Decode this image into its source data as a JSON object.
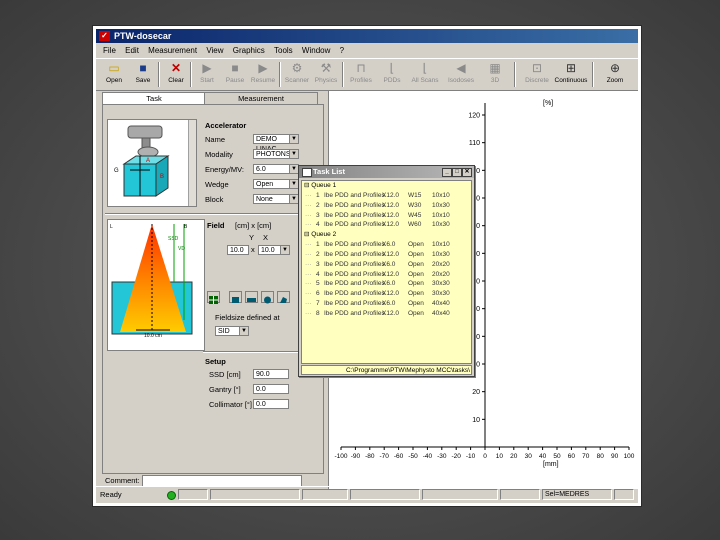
{
  "window": {
    "title": "PTW-dosecar"
  },
  "menu": [
    "File",
    "Edit",
    "Measurement",
    "View",
    "Graphics",
    "Tools",
    "Window",
    "?"
  ],
  "toolbar": [
    {
      "label": "Open",
      "icon": "open-folder-icon",
      "enabled": true
    },
    {
      "label": "Save",
      "icon": "save-disk-icon",
      "enabled": true
    },
    {
      "label": "Clear",
      "icon": "clear-x-icon",
      "enabled": true
    },
    {
      "label": "Start",
      "icon": "start-icon",
      "enabled": false
    },
    {
      "label": "Pause",
      "icon": "pause-icon",
      "enabled": false
    },
    {
      "label": "Resume",
      "icon": "resume-icon",
      "enabled": false
    },
    {
      "label": "Scanner",
      "icon": "scanner-icon",
      "enabled": false
    },
    {
      "label": "Physics",
      "icon": "physics-tools-icon",
      "enabled": false
    },
    {
      "label": "Profiles",
      "icon": "profiles-icon",
      "enabled": false
    },
    {
      "label": "PDDs",
      "icon": "pdds-icon",
      "enabled": false
    },
    {
      "label": "All Scans",
      "icon": "all-scans-icon",
      "enabled": false
    },
    {
      "label": "Isodoses",
      "icon": "isodoses-icon",
      "enabled": false
    },
    {
      "label": "3D",
      "icon": "3d-icon",
      "enabled": false
    },
    {
      "label": "Discrete",
      "icon": "discrete-icon",
      "enabled": false
    },
    {
      "label": "Continuous",
      "icon": "continuous-icon",
      "enabled": true
    },
    {
      "label": "Zoom",
      "icon": "zoom-icon",
      "enabled": true
    }
  ],
  "tabs": {
    "left": "Task",
    "right": "Measurement"
  },
  "accelerator": {
    "title": "Accelerator",
    "name_label": "Name",
    "name_value": "DEMO LINAC",
    "modality_label": "Modality",
    "modality_value": "PHOTONS",
    "energy_label": "Energy/MV:",
    "energy_value": "6.0",
    "wedge_label": "Wedge",
    "wedge_value": "Open",
    "block_label": "Block",
    "block_value": "None"
  },
  "field": {
    "title": "Field",
    "unit_text": "[cm] x [cm]",
    "y_label": "Y",
    "x_label": "X",
    "y_value": "10.0",
    "x_value": "10.0",
    "defined_label": "Fieldsize defined at",
    "defined_value": "SID"
  },
  "setup": {
    "title": "Setup",
    "ssd_label": "SSD [cm]",
    "ssd_value": "90.0",
    "gantry_label": "Gantry [°]",
    "gantry_value": "0.0",
    "collimator_label": "Collimator [°]",
    "collimator_value": "0.0"
  },
  "beam_diagram": {
    "ssd_label": "SSD",
    "vd_label": "VD",
    "width_label": "10.0 cm",
    "b_label": "B",
    "l_label": "L"
  },
  "comment": {
    "label": "Comment:",
    "value": ""
  },
  "statusbar": {
    "text": "Ready",
    "right_text": "Sel=MEDRES"
  },
  "chart_data": {
    "type": "line",
    "series": [],
    "ylabel": "[%]",
    "xlabel": "[mm]",
    "ylim": [
      0,
      120
    ],
    "xlim": [
      -100,
      100
    ],
    "y_ticks": [
      10,
      20,
      30,
      40,
      50,
      60,
      70,
      80,
      90,
      100,
      110,
      120
    ],
    "x_ticks": [
      -100,
      -90,
      -80,
      -70,
      -60,
      -50,
      -40,
      -30,
      -20,
      -10,
      0,
      10,
      20,
      30,
      40,
      50,
      60,
      70,
      80,
      90,
      100
    ]
  },
  "task_list": {
    "title": "Task List",
    "queues": [
      {
        "name": "Queue 1",
        "rows": [
          {
            "n": "1",
            "desc": "Ibe PDD and Profiles",
            "size": "X12.0",
            "wedge": "W15",
            "field": "10x10"
          },
          {
            "n": "2",
            "desc": "Ibe PDD and Profiles",
            "size": "X12.0",
            "wedge": "W30",
            "field": "10x30"
          },
          {
            "n": "3",
            "desc": "Ibe PDD and Profiles",
            "size": "X12.0",
            "wedge": "W45",
            "field": "10x10"
          },
          {
            "n": "4",
            "desc": "Ibe PDD and Profiles",
            "size": "X12.0",
            "wedge": "W60",
            "field": "10x30"
          }
        ]
      },
      {
        "name": "Queue 2",
        "rows": [
          {
            "n": "1",
            "desc": "Ibe PDD and Profiles",
            "size": "X6.0",
            "wedge": "Open",
            "field": "10x10"
          },
          {
            "n": "2",
            "desc": "Ibe PDD and Profiles",
            "size": "X12.0",
            "wedge": "Open",
            "field": "10x30"
          },
          {
            "n": "3",
            "desc": "Ibe PDD and Profiles",
            "size": "X6.0",
            "wedge": "Open",
            "field": "20x20"
          },
          {
            "n": "4",
            "desc": "Ibe PDD and Profiles",
            "size": "X12.0",
            "wedge": "Open",
            "field": "20x20"
          },
          {
            "n": "5",
            "desc": "Ibe PDD and Profiles",
            "size": "X6.0",
            "wedge": "Open",
            "field": "30x30"
          },
          {
            "n": "6",
            "desc": "Ibe PDD and Profiles",
            "size": "X12.0",
            "wedge": "Open",
            "field": "30x30"
          },
          {
            "n": "7",
            "desc": "Ibe PDD and Profiles",
            "size": "X6.0",
            "wedge": "Open",
            "field": "40x40"
          },
          {
            "n": "8",
            "desc": "Ibe PDD and Profiles",
            "size": "X12.0",
            "wedge": "Open",
            "field": "40x40"
          }
        ]
      }
    ],
    "path": "C:\\Programme\\PTW\\Mephysto MCC\\tasks\\"
  }
}
